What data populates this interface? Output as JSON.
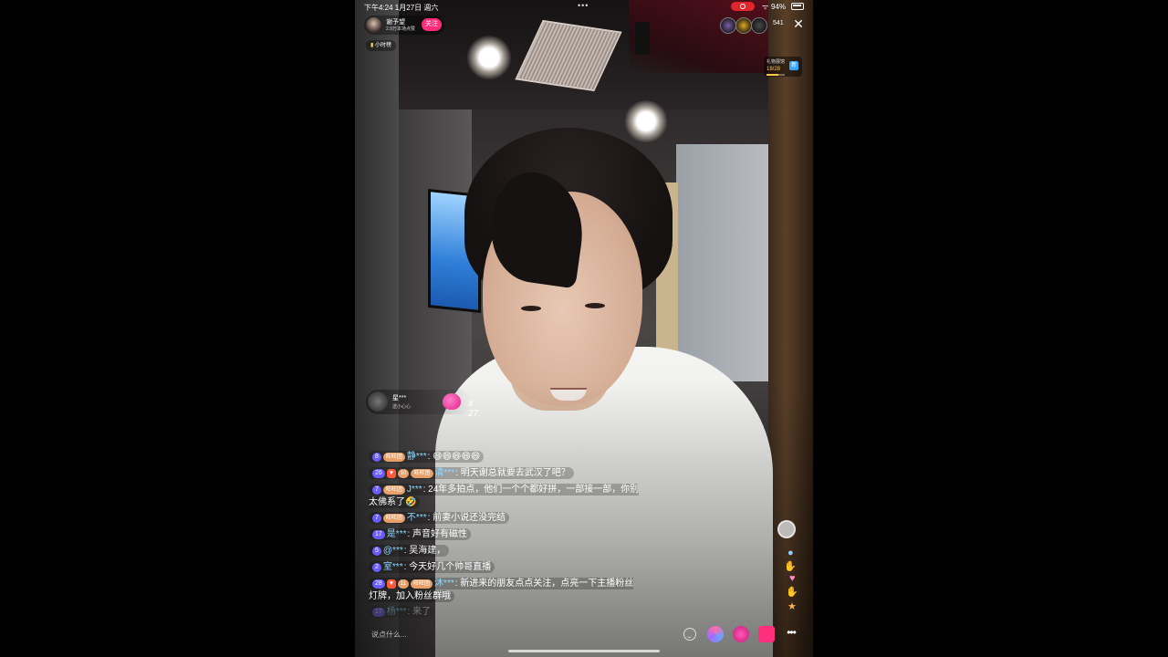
{
  "status_bar": {
    "time": "下午4:24  1月27日 週六",
    "dots": "•••",
    "battery": "94%"
  },
  "host": {
    "name": "谢予望",
    "likes": "2.9万本场点赞",
    "follow_label": "关注",
    "rank_label": "小时榜"
  },
  "viewers": {
    "count": "541",
    "avatar_colors": [
      "#7b5ea7",
      "#e0a81c",
      "#4a4a4a"
    ]
  },
  "gift_box": {
    "label": "礼物展馆",
    "progress": "18/28",
    "progress_fraction": 0.64,
    "icon": "新"
  },
  "gift_notification": {
    "user": "星***",
    "gift": "送小心心",
    "combo": "x 27"
  },
  "comments": [
    {
      "level": "8",
      "fan": "旺旺团",
      "vip": false,
      "user": "静***",
      "text": "😄😄😄😄😄",
      "faded": false
    },
    {
      "level": "26",
      "fan": "旺旺团",
      "fan_level": "10",
      "vip": true,
      "user": "清***",
      "text": "明天谢总就要去武汉了吧？",
      "faded": false
    },
    {
      "level": "7",
      "fan": "旺旺团",
      "vip": false,
      "user": "J***",
      "text": "24年多拍点，他们一个个都好拼，一部接一部，你别太佛系了🤣",
      "faded": false
    },
    {
      "level": "7",
      "fan": "旺旺团",
      "vip": false,
      "user": "不***",
      "text": "前妻小说还没完结",
      "faded": false
    },
    {
      "level": "17",
      "fan": "",
      "vip": false,
      "user": "是***",
      "text": "声音好有磁性",
      "faded": false
    },
    {
      "level": "5",
      "fan": "",
      "vip": false,
      "user": "@***",
      "text": "吴海建，",
      "faded": false
    },
    {
      "level": "2",
      "fan": "",
      "vip": false,
      "user": "室***",
      "text": "今天好几个帅哥直播",
      "faded": false
    },
    {
      "level": "28",
      "fan": "旺旺团",
      "fan_level": "11",
      "vip": true,
      "user": "沐***",
      "text": "新进来的朋友点点关注，点亮一下主播粉丝灯牌，加入粉丝群哦",
      "faded": false
    },
    {
      "level": "17",
      "fan": "",
      "vip": false,
      "user": "杨***",
      "text": "来了",
      "faded": true
    }
  ],
  "input": {
    "placeholder": "说点什么..."
  },
  "more_label": "•••",
  "close_label": "✕",
  "icons": {
    "close": "close-icon",
    "emoji": "smile-icon",
    "share": "share-icon",
    "gift": "gift-icon",
    "shop": "shop-icon",
    "more": "more-icon",
    "rank": "bar-chart-icon"
  },
  "colors": {
    "accent": "#fe2c78",
    "username": "#8fd6ff",
    "level_badge": "#6a5cff",
    "fan_badge": "#e8a06a"
  }
}
